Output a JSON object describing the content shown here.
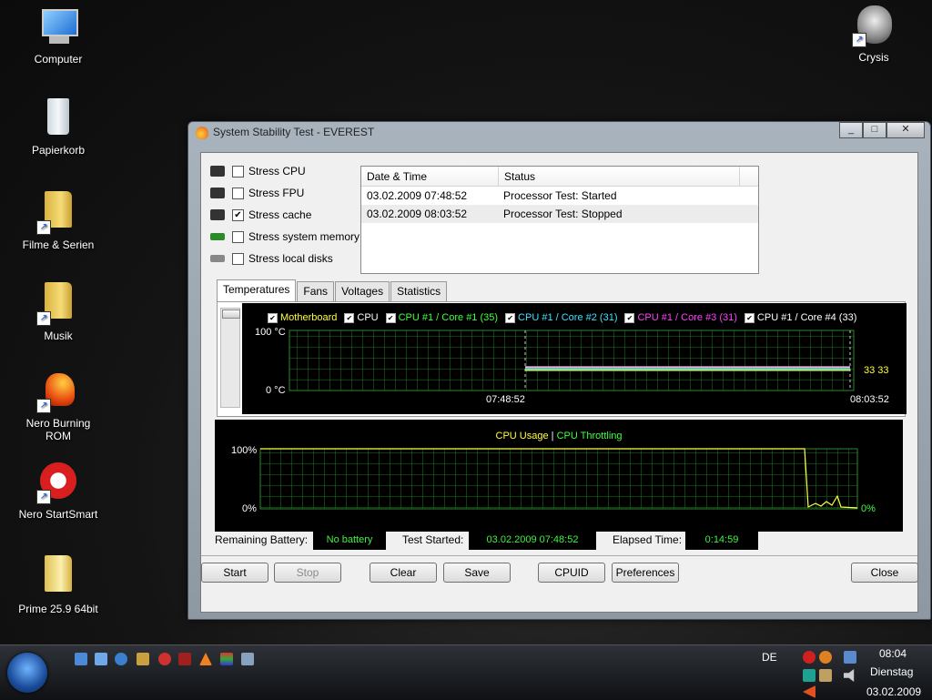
{
  "desktop": {
    "icons": [
      "Computer",
      "Papierkorb",
      "Filme & Serien",
      "Musik",
      "Nero Burning ROM",
      "Nero StartSmart",
      "Prime 25.9 64bit",
      "Crysis"
    ]
  },
  "window": {
    "title": "System Stability Test - EVEREST",
    "buttons": {
      "minimize": "_",
      "maximize": "□",
      "close": "✕"
    }
  },
  "stress": [
    {
      "label": "Stress CPU",
      "checked": false
    },
    {
      "label": "Stress FPU",
      "checked": false
    },
    {
      "label": "Stress cache",
      "checked": true
    },
    {
      "label": "Stress system memory",
      "checked": false
    },
    {
      "label": "Stress local disks",
      "checked": false
    }
  ],
  "log": {
    "columns": [
      "Date & Time",
      "Status"
    ],
    "rows": [
      [
        "03.02.2009 07:48:52",
        "Processor Test: Started"
      ],
      [
        "03.02.2009 08:03:52",
        "Processor Test: Stopped"
      ]
    ]
  },
  "tabs": [
    "Temperatures",
    "Fans",
    "Voltages",
    "Statistics"
  ],
  "temp_chart": {
    "legend": [
      {
        "label": "Motherboard",
        "color": "#ffff40"
      },
      {
        "label": "CPU",
        "color": "#ffffff"
      },
      {
        "label": "CPU #1 / Core #1 (35)",
        "color": "#40ff40"
      },
      {
        "label": "CPU #1 / Core #2 (31)",
        "color": "#40e0ff"
      },
      {
        "label": "CPU #1 / Core #3 (31)",
        "color": "#ff40ff"
      },
      {
        "label": "CPU #1 / Core #4 (33)",
        "color": "#ffffff"
      }
    ],
    "y_top": "100 °C",
    "y_bottom": "0 °C",
    "x_start": "07:48:52",
    "x_end": "08:03:52",
    "end_values": "33 33"
  },
  "cpu_chart": {
    "title_usage": "CPU Usage",
    "title_sep": "|",
    "title_throttle": "CPU Throttling",
    "y_top": "100%",
    "y_bottom": "0%",
    "end_value": "0%"
  },
  "info": {
    "battery_label": "Remaining Battery:",
    "battery_value": "No battery",
    "started_label": "Test Started:",
    "started_value": "03.02.2009 07:48:52",
    "elapsed_label": "Elapsed Time:",
    "elapsed_value": "0:14:59"
  },
  "buttons": {
    "start": "Start",
    "stop": "Stop",
    "clear": "Clear",
    "save": "Save",
    "cpuid": "CPUID",
    "preferences": "Preferences",
    "close": "Close"
  },
  "tray": {
    "lang": "DE",
    "time": "08:04",
    "day": "Dienstag",
    "date": "03.02.2009"
  }
}
